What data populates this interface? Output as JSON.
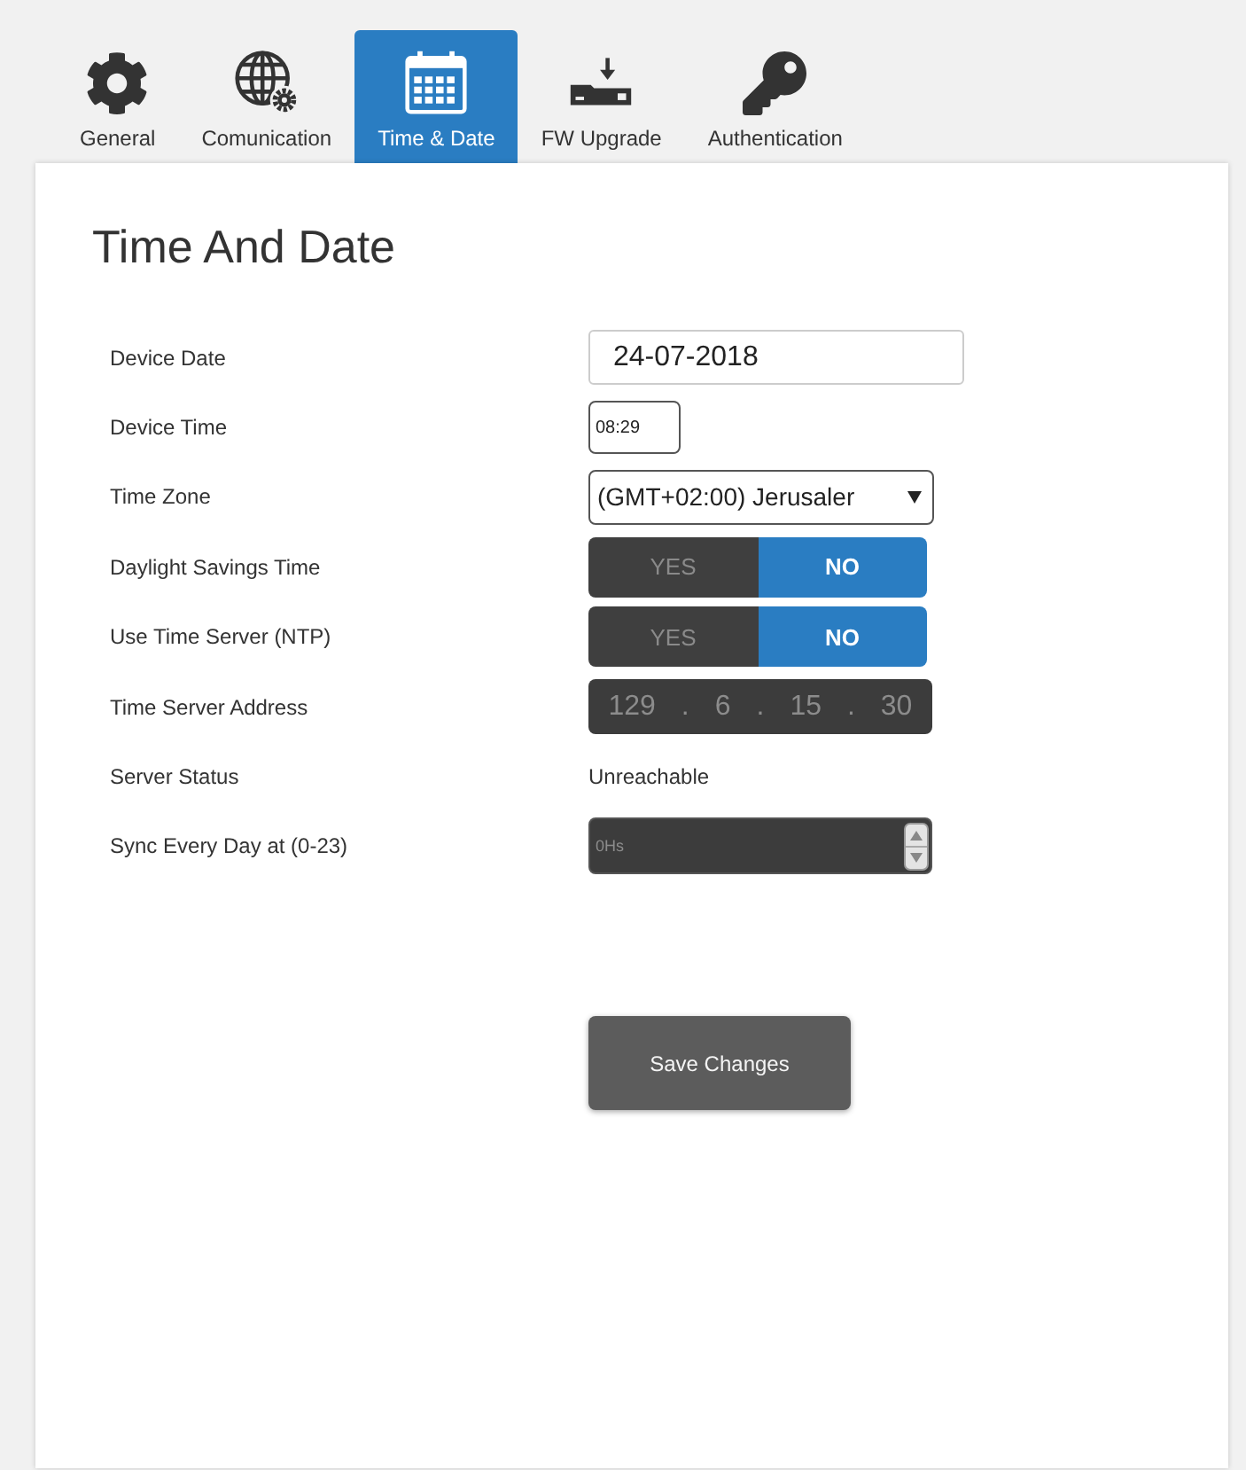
{
  "tabs": [
    {
      "label": "General",
      "selected": false
    },
    {
      "label": "Comunication",
      "selected": false
    },
    {
      "label": "Time & Date",
      "selected": true
    },
    {
      "label": "FW Upgrade",
      "selected": false
    },
    {
      "label": "Authentication",
      "selected": false
    }
  ],
  "title": "Time And Date",
  "fields": [
    {
      "kind": "date",
      "label": "Device Date",
      "value": "24-07-2018"
    },
    {
      "kind": "time",
      "label": "Device Time",
      "value": "08:29"
    },
    {
      "kind": "select",
      "label": "Time Zone",
      "value": "(GMT+02:00) Jerusaler"
    },
    {
      "kind": "toggle",
      "label": "Daylight Savings Time",
      "options": [
        {
          "label": "YES",
          "selected": false
        },
        {
          "label": "NO",
          "selected": true
        }
      ]
    },
    {
      "kind": "toggle",
      "label": "Use Time Server (NTP)",
      "options": [
        {
          "label": "YES",
          "selected": false
        },
        {
          "label": "NO",
          "selected": true
        }
      ]
    },
    {
      "kind": "ip",
      "label": "Time Server Address",
      "octets": [
        "129",
        "6",
        "15",
        "30"
      ],
      "separator": "."
    },
    {
      "kind": "status",
      "label": "Server Status",
      "value": "Unreachable"
    },
    {
      "kind": "number",
      "label": "Sync Every Day at (0-23)",
      "placeholder": "0Hs"
    }
  ],
  "save_button": {
    "label": "Save Changes"
  }
}
